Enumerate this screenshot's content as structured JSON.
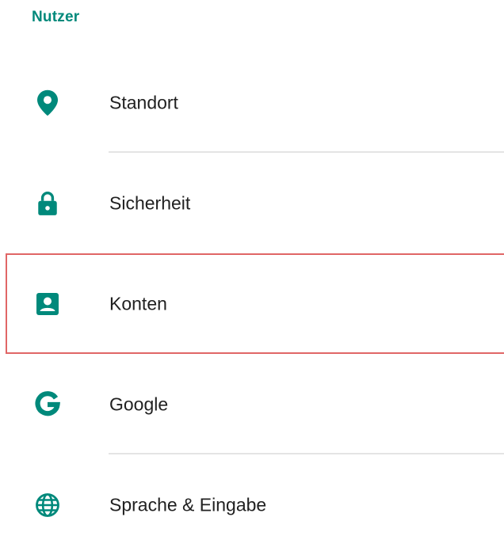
{
  "section": {
    "title": "Nutzer"
  },
  "accent_color": "#00897b",
  "highlight_color": "#e06666",
  "items": [
    {
      "label": "Standort",
      "icon": "location-pin-icon"
    },
    {
      "label": "Sicherheit",
      "icon": "lock-icon"
    },
    {
      "label": "Konten",
      "icon": "account-box-icon",
      "highlighted": true
    },
    {
      "label": "Google",
      "icon": "google-icon"
    },
    {
      "label": "Sprache & Eingabe",
      "icon": "globe-icon"
    }
  ]
}
